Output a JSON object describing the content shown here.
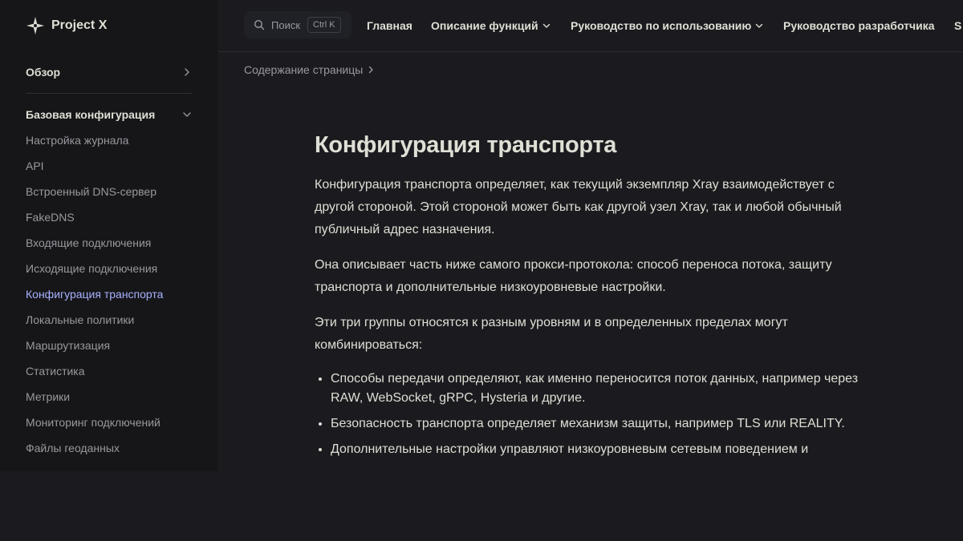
{
  "brand": {
    "name": "Project X",
    "logo_icon": "sparkle-icon"
  },
  "search": {
    "placeholder": "Поиск",
    "shortcut": "Ctrl K"
  },
  "nav": {
    "items": [
      {
        "label": "Главная",
        "dropdown": false
      },
      {
        "label": "Описание функций",
        "dropdown": true
      },
      {
        "label": "Руководство по использованию",
        "dropdown": true
      },
      {
        "label": "Руководство разработчика",
        "dropdown": false
      },
      {
        "label": "S",
        "dropdown": false
      }
    ]
  },
  "local_nav": {
    "toc_label": "Содержание страницы"
  },
  "sidebar": {
    "overview_label": "Обзор",
    "group_title": "Базовая конфигурация",
    "items": [
      {
        "label": "Настройка журнала"
      },
      {
        "label": "API"
      },
      {
        "label": "Встроенный DNS-сервер"
      },
      {
        "label": "FakeDNS"
      },
      {
        "label": "Входящие подключения"
      },
      {
        "label": "Исходящие подключения"
      },
      {
        "label": "Конфигурация транспорта",
        "active": true
      },
      {
        "label": "Локальные политики"
      },
      {
        "label": "Маршрутизация"
      },
      {
        "label": "Статистика"
      },
      {
        "label": "Метрики"
      },
      {
        "label": "Мониторинг подключений"
      },
      {
        "label": "Файлы геоданных"
      }
    ]
  },
  "article": {
    "title": "Конфигурация транспорта",
    "paragraphs": [
      "Конфигурация транспорта определяет, как текущий экземпляр Xray взаимодействует с другой стороной. Этой стороной может быть как другой узел Xray, так и любой обычный публичный адрес назначения.",
      "Она описывает часть ниже самого прокси-протокола: способ переноса потока, защиту транспорта и дополнительные низкоуровневые настройки.",
      "Эти три группы относятся к разным уровням и в определенных пределах могут комбинироваться:"
    ],
    "bullets": [
      "Способы передачи определяют, как именно переносится поток данных, например через RAW, WebSocket, gRPC, Hysteria и другие.",
      "Безопасность транспорта определяет механизм защиты, например TLS или REALITY.",
      "Дополнительные настройки управляют низкоуровневым сетевым поведением и"
    ]
  },
  "colors": {
    "background": "#1b1b1f",
    "sidebar_bg": "#161618",
    "text": "#dfdfd6",
    "muted": "#98989f",
    "accent": "#a8b1ff"
  }
}
